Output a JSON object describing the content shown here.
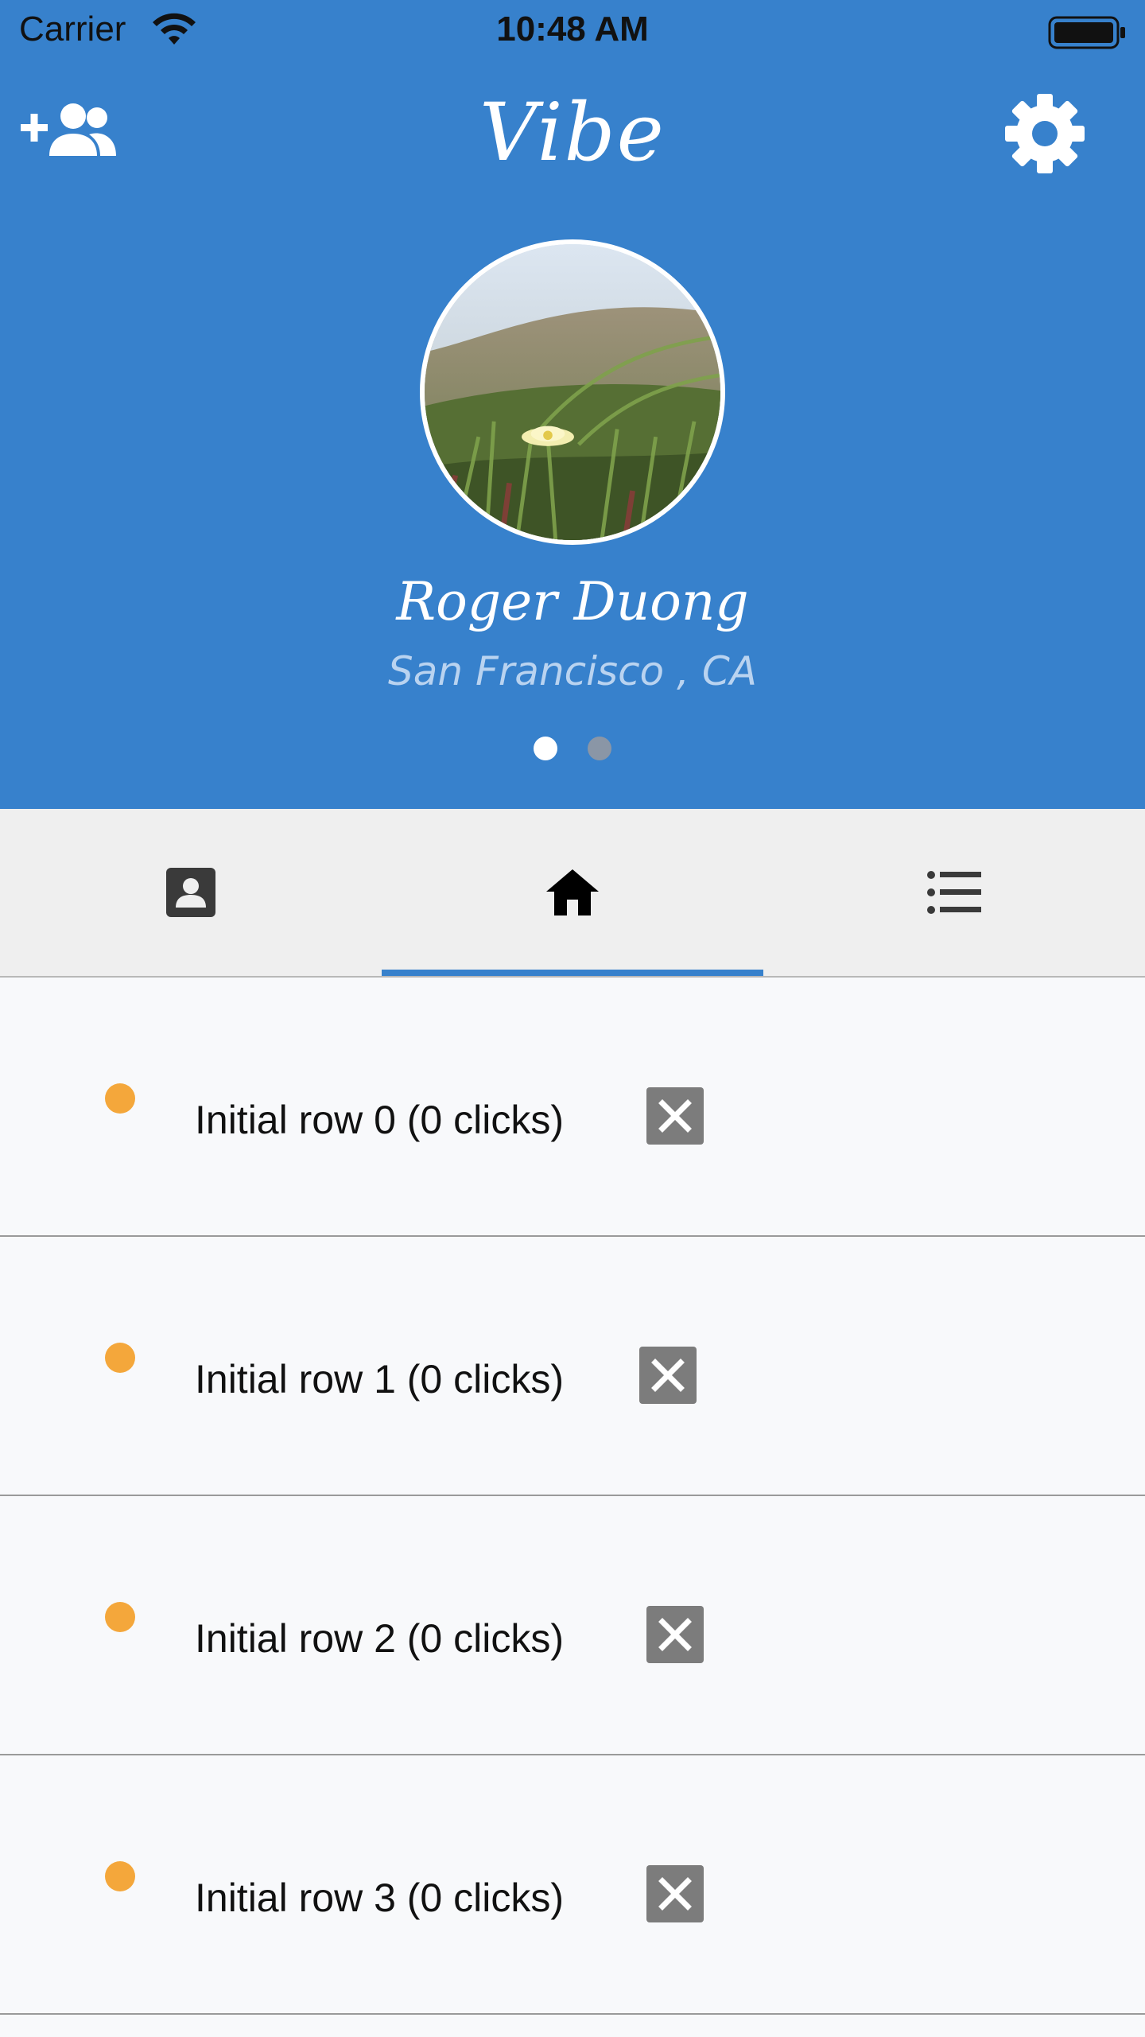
{
  "status_bar": {
    "carrier": "Carrier",
    "time": "10:48 AM",
    "wifi_icon": "wifi-icon",
    "battery_icon": "battery-icon"
  },
  "nav": {
    "title": "Vibe",
    "left_icon": "add-friend-icon",
    "right_icon": "settings-icon"
  },
  "profile": {
    "name": "Roger Duong",
    "location": "San Francisco , CA",
    "page_count": 2,
    "current_page": 1
  },
  "tabs": [
    {
      "icon": "contact-card-icon",
      "active": false
    },
    {
      "icon": "home-icon",
      "active": true
    },
    {
      "icon": "list-icon",
      "active": false
    }
  ],
  "rows": [
    {
      "label": "Initial row 0 (0 clicks)"
    },
    {
      "label": "Initial row 1 (0 clicks)"
    },
    {
      "label": "Initial row 2 (0 clicks)"
    },
    {
      "label": "Initial row 3 (0 clicks)"
    }
  ],
  "colors": {
    "header_blue": "#3781cc",
    "row_dot_orange": "#f4a73b",
    "delete_button_gray": "#7c7c7c",
    "tab_bar_bg": "#efefef",
    "list_bg": "#f8f9fb"
  }
}
